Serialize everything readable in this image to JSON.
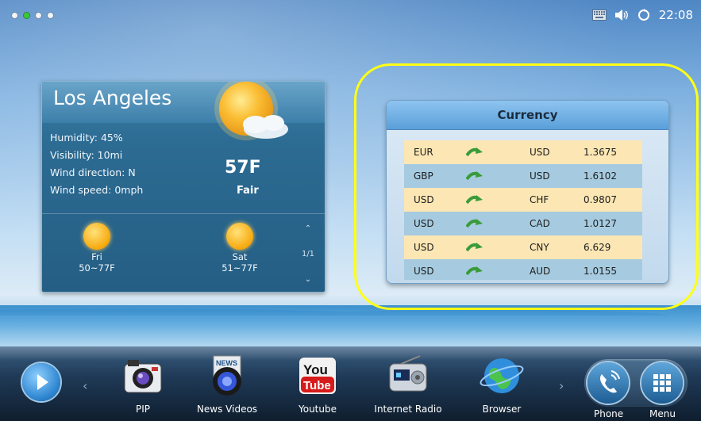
{
  "status_bar": {
    "time": "22:08",
    "page_dots": 4,
    "active_dot_index": 1,
    "icons": [
      "keyboard-icon",
      "volume-icon",
      "sync-icon"
    ]
  },
  "weather": {
    "city": "Los Angeles",
    "humidity": "Humidity: 45%",
    "visibility": "Visibility: 10mi",
    "wind_direction": "Wind direction: N",
    "wind_speed": "Wind speed: 0mph",
    "temperature": "57F",
    "condition": "Fair",
    "forecast": [
      {
        "day": "Fri",
        "range": "50~77F",
        "icon": "sun-icon"
      },
      {
        "day": "Sat",
        "range": "51~77F",
        "icon": "sun-icon"
      }
    ],
    "pager": "1/1"
  },
  "currency": {
    "title": "Currency",
    "rows": [
      {
        "from": "EUR",
        "to": "USD",
        "rate": "1.3675"
      },
      {
        "from": "GBP",
        "to": "USD",
        "rate": "1.6102"
      },
      {
        "from": "USD",
        "to": "CHF",
        "rate": "0.9807"
      },
      {
        "from": "USD",
        "to": "CAD",
        "rate": "1.0127"
      },
      {
        "from": "USD",
        "to": "CNY",
        "rate": "6.629"
      },
      {
        "from": "USD",
        "to": "AUD",
        "rate": "1.0155"
      }
    ]
  },
  "dock": {
    "apps": [
      {
        "label": "PIP",
        "icon": "camera-icon"
      },
      {
        "label": "News Videos",
        "icon": "news-video-icon"
      },
      {
        "label": "Youtube",
        "icon": "youtube-icon"
      },
      {
        "label": "Internet Radio",
        "icon": "radio-icon"
      },
      {
        "label": "Browser",
        "icon": "globe-icon"
      }
    ],
    "phone_label": "Phone",
    "menu_label": "Menu",
    "youtube_you": "You",
    "youtube_tube": "Tube",
    "news_badge": "NEWS"
  },
  "colors": {
    "highlight": "#ffff14",
    "active_dot": "#3cc83c"
  }
}
